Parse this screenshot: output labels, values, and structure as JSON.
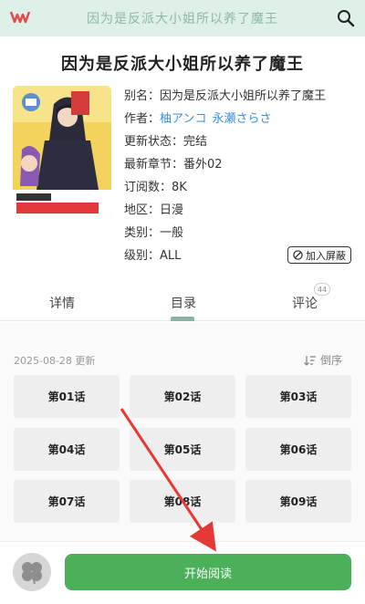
{
  "header": {
    "title": "因为是反派大小姐所以养了魔王"
  },
  "manga": {
    "title": "因为是反派大小姐所以养了魔王",
    "cover_icon": "manga-cover-image",
    "info": [
      {
        "label": "别名：",
        "value": "因为是反派大小姐所以养了魔王"
      },
      {
        "label": "作者：",
        "value": ""
      },
      {
        "label": "更新状态：",
        "value": "完结"
      },
      {
        "label": "最新章节：",
        "value": "番外02"
      },
      {
        "label": "订阅数：",
        "value": "8K"
      },
      {
        "label": "地区：",
        "value": "日漫"
      },
      {
        "label": "类别：",
        "value": "一般"
      },
      {
        "label": "级别：",
        "value": "ALL"
      }
    ],
    "authors": [
      "柚アンコ",
      "永瀬さらさ"
    ],
    "block_label": "加入屏蔽"
  },
  "tabs": {
    "detail": "详情",
    "toc": "目录",
    "comment": "评论",
    "comment_count": "44"
  },
  "chapters": {
    "update_date": "2025-08-28 更新",
    "sort_label": "倒序",
    "items": [
      "第01话",
      "第02话",
      "第03话",
      "第04话",
      "第05话",
      "第06话",
      "第07话",
      "第08话",
      "第09话"
    ]
  },
  "bottom": {
    "read_label": "开始阅读"
  },
  "colors": {
    "accent_green": "#4caf5a",
    "author_link": "#3a8fd6",
    "topbar_bg": "#dff0e8",
    "arrow_red": "#e53935"
  }
}
